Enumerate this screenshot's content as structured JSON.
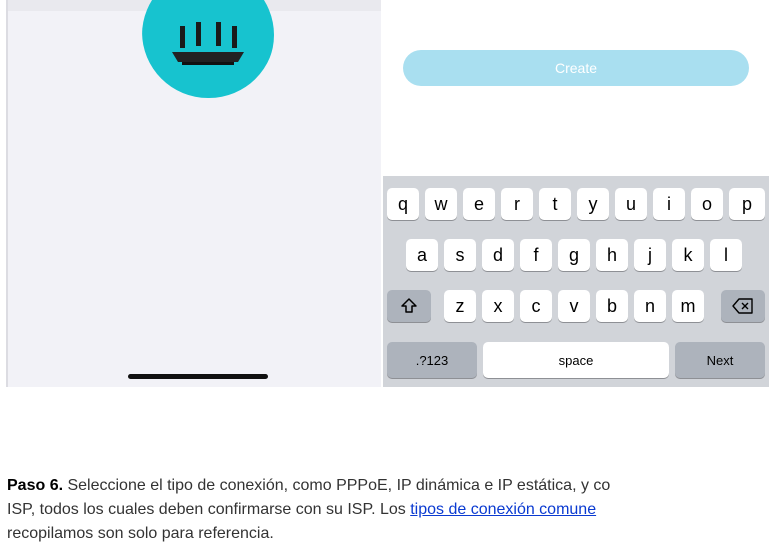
{
  "create_button": {
    "label": "Create"
  },
  "keyboard": {
    "row1": [
      "q",
      "w",
      "e",
      "r",
      "t",
      "y",
      "u",
      "i",
      "o",
      "p"
    ],
    "row2": [
      "a",
      "s",
      "d",
      "f",
      "g",
      "h",
      "j",
      "k",
      "l"
    ],
    "row3": [
      "z",
      "x",
      "c",
      "v",
      "b",
      "n",
      "m"
    ],
    "shift_icon": "shift-arrow-icon",
    "delete_icon": "backspace-icon",
    "numbers_label": ".?123",
    "space_label": "space",
    "next_label": "Next"
  },
  "router_icon": "router-icon",
  "caption": {
    "step_label": "Paso 6.",
    "line1_text": " Seleccione el tipo de conexión, como PPPoE, IP dinámica e IP estática, y co",
    "line2_text": "ISP, todos los cuales deben confirmarse con su ISP. Los ",
    "link_text": "tipos de conexión comune",
    "line3_text": "recopilamos son solo para referencia."
  },
  "colors": {
    "accent_circle": "#17c3cf",
    "create_button": "#a9dff0",
    "link": "#0a3ad1"
  }
}
